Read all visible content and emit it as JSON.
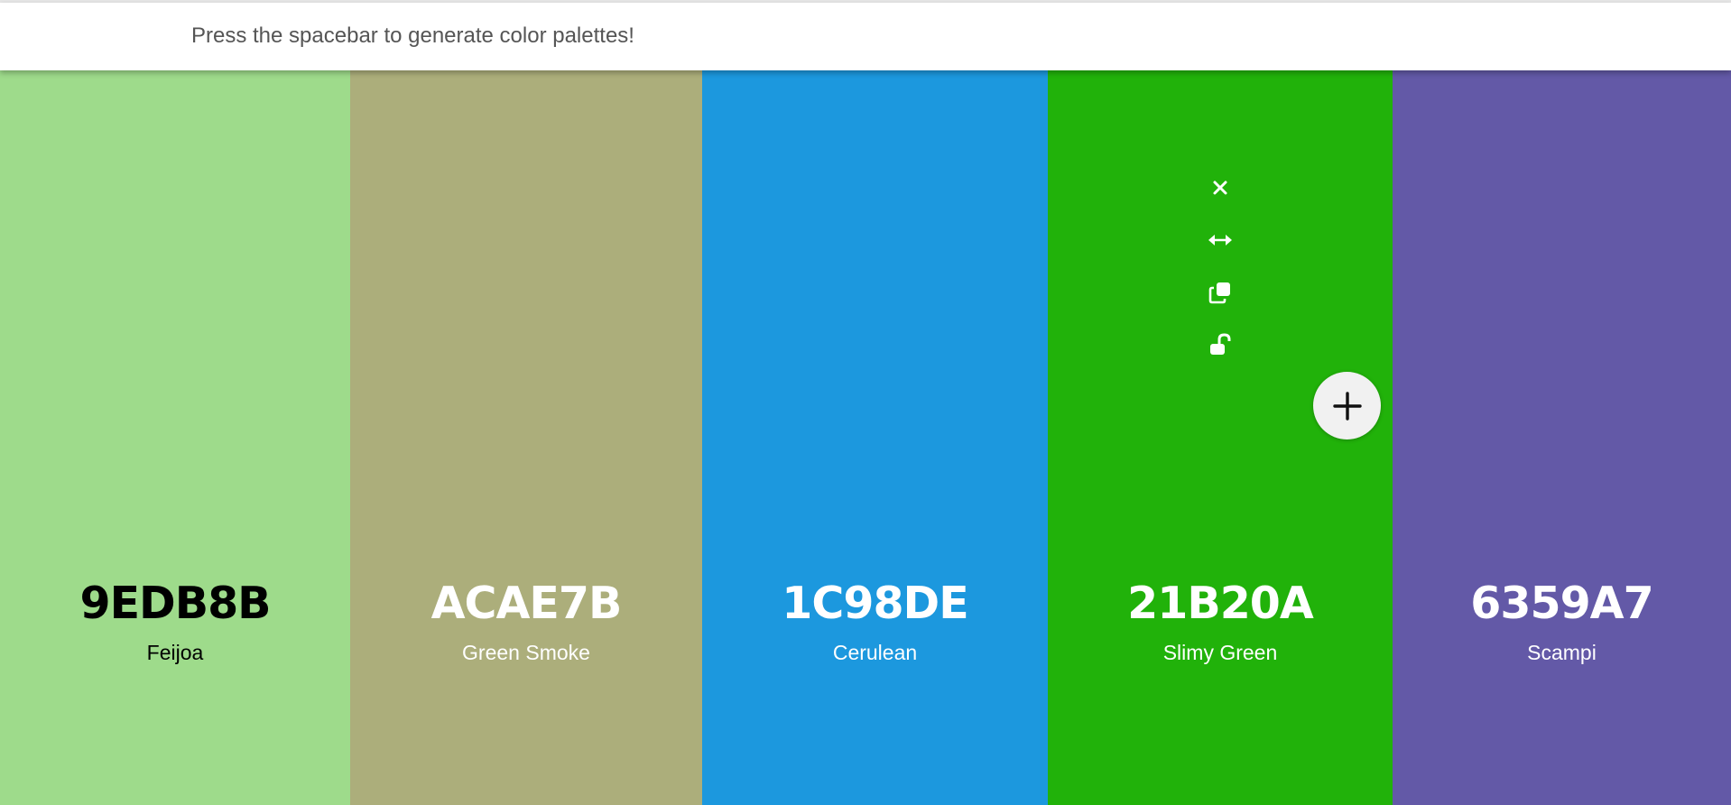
{
  "header": {
    "message": "Press the spacebar to generate color palettes!"
  },
  "swatches": [
    {
      "hex": "9EDB8B",
      "name": "Feijoa",
      "background": "#9EDB8B",
      "text_color": "#000000"
    },
    {
      "hex": "ACAE7B",
      "name": "Green Smoke",
      "background": "#ACAE7B",
      "text_color": "#ffffff"
    },
    {
      "hex": "1C98DE",
      "name": "Cerulean",
      "background": "#1C98DE",
      "text_color": "#ffffff"
    },
    {
      "hex": "21B20A",
      "name": "Slimy Green",
      "background": "#21B20A",
      "text_color": "#ffffff",
      "tools": [
        "close-icon",
        "drag-arrows-icon",
        "copy-icon",
        "unlock-icon"
      ]
    },
    {
      "hex": "6359A7",
      "name": "Scampi",
      "background": "#6359A7",
      "text_color": "#ffffff"
    }
  ],
  "add_button": {
    "icon": "plus-icon",
    "background": "#F1F1F1"
  }
}
